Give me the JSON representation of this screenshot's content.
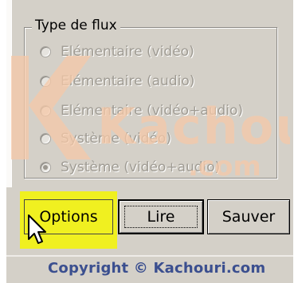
{
  "group": {
    "title": "Type de flux",
    "options": [
      {
        "label": "Elémentaire (vidéo)",
        "checked": false
      },
      {
        "label": "Elémentaire (audio)",
        "checked": false
      },
      {
        "label": "Elémentaire (vidéo+audio)",
        "checked": false
      },
      {
        "label": "Système (vidéo)",
        "checked": false
      },
      {
        "label": "Système (vidéo+audio)",
        "checked": true
      }
    ]
  },
  "buttons": {
    "options": "Options",
    "lire": "Lire",
    "sauver": "Sauver"
  },
  "watermark": {
    "text": "Kachouri",
    "sub": ".com",
    "color": "#f6c9a8"
  },
  "highlight_color": "#f0f020",
  "footer": {
    "copyright": "Copyright © Kachouri.com"
  }
}
